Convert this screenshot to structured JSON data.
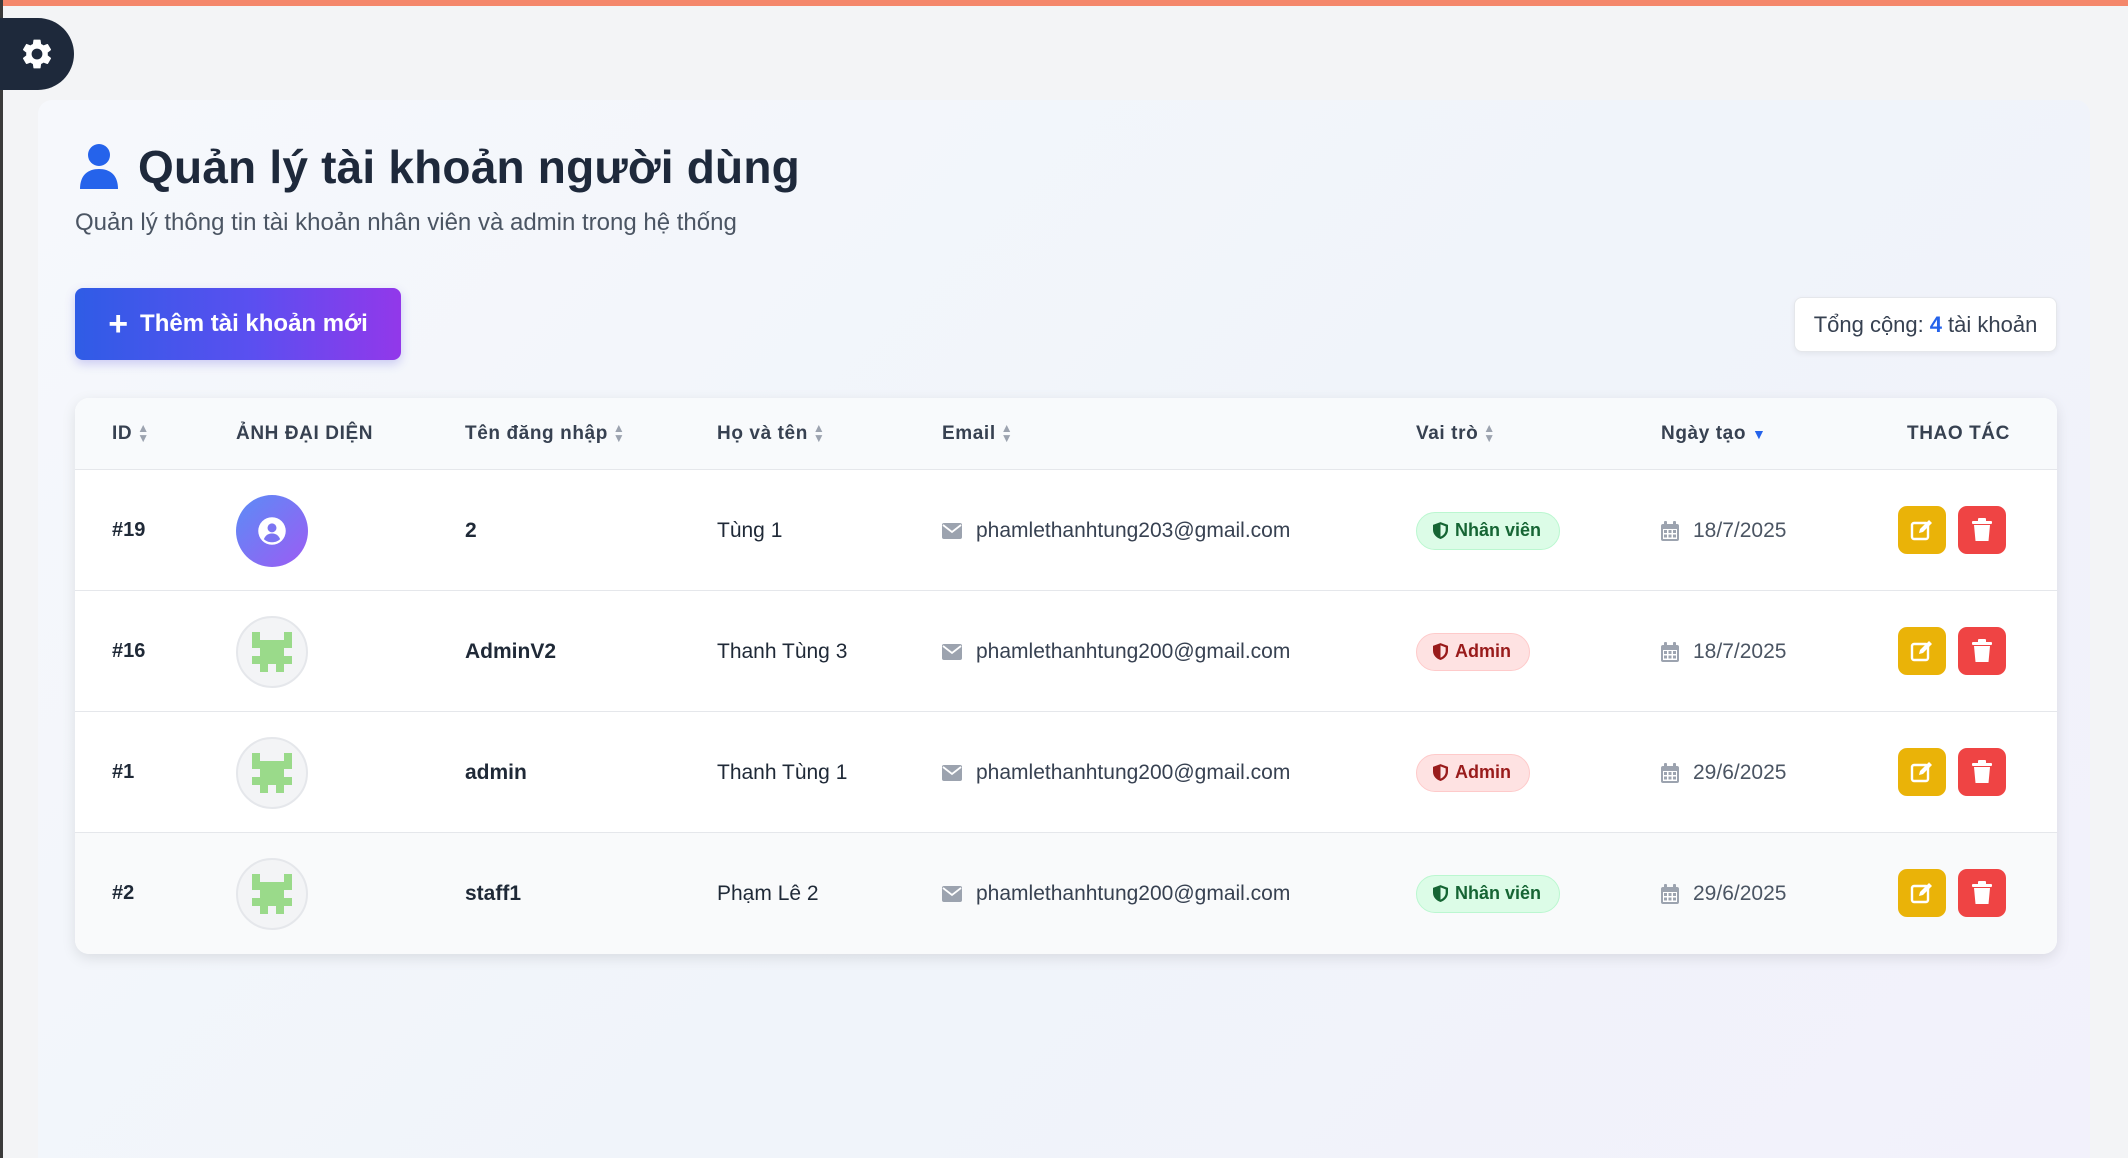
{
  "page": {
    "title": "Quản lý tài khoản người dùng",
    "subtitle": "Quản lý thông tin tài khoản nhân viên và admin trong hệ thống"
  },
  "toolbar": {
    "add_label": "Thêm tài khoản mới",
    "total_prefix": "Tổng cộng:",
    "total_count": "4",
    "total_suffix": "tài khoản"
  },
  "table": {
    "headers": {
      "id": "ID",
      "avatar": "ẢNH ĐẠI DIỆN",
      "username": "Tên đăng nhập",
      "fullname": "Họ và tên",
      "email": "Email",
      "role": "Vai trò",
      "created": "Ngày tạo",
      "actions": "THAO TÁC"
    },
    "rows": [
      {
        "id": "#19",
        "avatar": "default-user-icon",
        "username": "2",
        "fullname": "Tùng 1",
        "email": "phamlethanhtung203@gmail.com",
        "role": "Nhân viên",
        "role_type": "staff",
        "created": "18/7/2025"
      },
      {
        "id": "#16",
        "avatar": "pixel-identicon",
        "username": "AdminV2",
        "fullname": "Thanh Tùng 3",
        "email": "phamlethanhtung200@gmail.com",
        "role": "Admin",
        "role_type": "admin",
        "created": "18/7/2025"
      },
      {
        "id": "#1",
        "avatar": "pixel-identicon",
        "username": "admin",
        "fullname": "Thanh Tùng 1",
        "email": "phamlethanhtung200@gmail.com",
        "role": "Admin",
        "role_type": "admin",
        "created": "29/6/2025"
      },
      {
        "id": "#2",
        "avatar": "pixel-identicon",
        "username": "staff1",
        "fullname": "Phạm Lê 2",
        "email": "phamlethanhtung200@gmail.com",
        "role": "Nhân viên",
        "role_type": "staff",
        "created": "29/6/2025"
      }
    ]
  },
  "colors": {
    "accent": "#2563eb",
    "top_bar": "#f4876b",
    "edit": "#eab308",
    "delete": "#ef4444"
  }
}
